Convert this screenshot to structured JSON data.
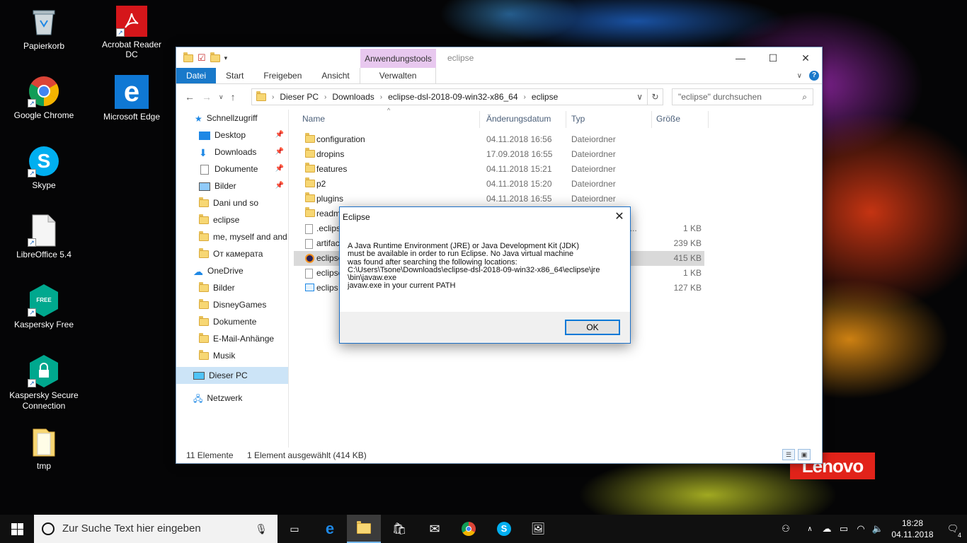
{
  "desktop": {
    "icons": [
      {
        "label": "Papierkorb",
        "icon": "recycle-bin"
      },
      {
        "label": "Acrobat Reader DC",
        "icon": "acrobat"
      },
      {
        "label": "Google Chrome",
        "icon": "chrome"
      },
      {
        "label": "Microsoft Edge",
        "icon": "edge"
      },
      {
        "label": "Skype",
        "icon": "skype"
      },
      {
        "label": "LibreOffice 5.4",
        "icon": "libreoffice"
      },
      {
        "label": "Kaspersky Free",
        "icon": "kaspersky"
      },
      {
        "label": "Kaspersky Secure\nConnection",
        "icon": "kaspersky-secure"
      },
      {
        "label": "tmp",
        "icon": "folder"
      }
    ],
    "kaspersky_badge": "FREE",
    "brand": "Lenovo",
    "brand_color": "#e2231a"
  },
  "explorer": {
    "title": "eclipse",
    "context_tab": "Anwendungstools",
    "context_tab_color": "#e8c8ef",
    "ribbon_tabs": [
      "Datei",
      "Start",
      "Freigeben",
      "Ansicht",
      "Verwalten"
    ],
    "address": [
      "Dieser PC",
      "Downloads",
      "eclipse-dsl-2018-09-win32-x86_64",
      "eclipse"
    ],
    "search_placeholder": "\"eclipse\" durchsuchen",
    "columns": {
      "name": "Name",
      "date": "Änderungsdatum",
      "type": "Typ",
      "size": "Größe"
    },
    "sidebar": {
      "quick_access": "Schnellzugriff",
      "quick_items": [
        "Desktop",
        "Downloads",
        "Dokumente",
        "Bilder",
        "Dani und so",
        "eclipse",
        "me, myself and and",
        "От камерата"
      ],
      "onedrive": "OneDrive",
      "onedrive_items": [
        "Bilder",
        "DisneyGames",
        "Dokumente",
        "E-Mail-Anhänge",
        "Musik"
      ],
      "this_pc": "Dieser PC",
      "network": "Netzwerk"
    },
    "files": [
      {
        "name": "configuration",
        "date": "04.11.2018 16:56",
        "type": "Dateiordner",
        "size": ""
      },
      {
        "name": "dropins",
        "date": "17.09.2018 16:55",
        "type": "Dateiordner",
        "size": ""
      },
      {
        "name": "features",
        "date": "04.11.2018 15:21",
        "type": "Dateiordner",
        "size": ""
      },
      {
        "name": "p2",
        "date": "04.11.2018 15:20",
        "type": "Dateiordner",
        "size": ""
      },
      {
        "name": "plugins",
        "date": "04.11.2018 16:55",
        "type": "Dateiordner",
        "size": ""
      },
      {
        "name": "readm",
        "date": "",
        "type": "",
        "size": ""
      },
      {
        "name": ".eclips",
        "date": "",
        "type": "CT...",
        "size": "1 KB"
      },
      {
        "name": "artifac",
        "date": "",
        "type": "",
        "size": "239 KB"
      },
      {
        "name": "eclipse",
        "date": "",
        "type": "",
        "size": "415 KB"
      },
      {
        "name": "eclipse",
        "date": "",
        "type": "",
        "size": "1 KB"
      },
      {
        "name": "eclips",
        "date": "",
        "type": "",
        "size": "127 KB"
      }
    ],
    "status_count": "11 Elemente",
    "status_selection": "1 Element ausgewählt (414 KB)"
  },
  "dialog": {
    "title": "Eclipse",
    "message": "A Java Runtime Environment (JRE) or Java Development Kit (JDK)\nmust be available in order to run Eclipse. No Java virtual machine\nwas found after searching the following locations:\nC:\\Users\\Tsone\\Downloads\\eclipse-dsl-2018-09-win32-x86_64\\eclipse\\jre\n\\bin\\javaw.exe\njavaw.exe in your current PATH",
    "ok_label": "OK"
  },
  "taskbar": {
    "search_placeholder": "Zur Suche Text hier eingeben",
    "time": "18:28",
    "date": "04.11.2018",
    "notification_count": "4"
  }
}
